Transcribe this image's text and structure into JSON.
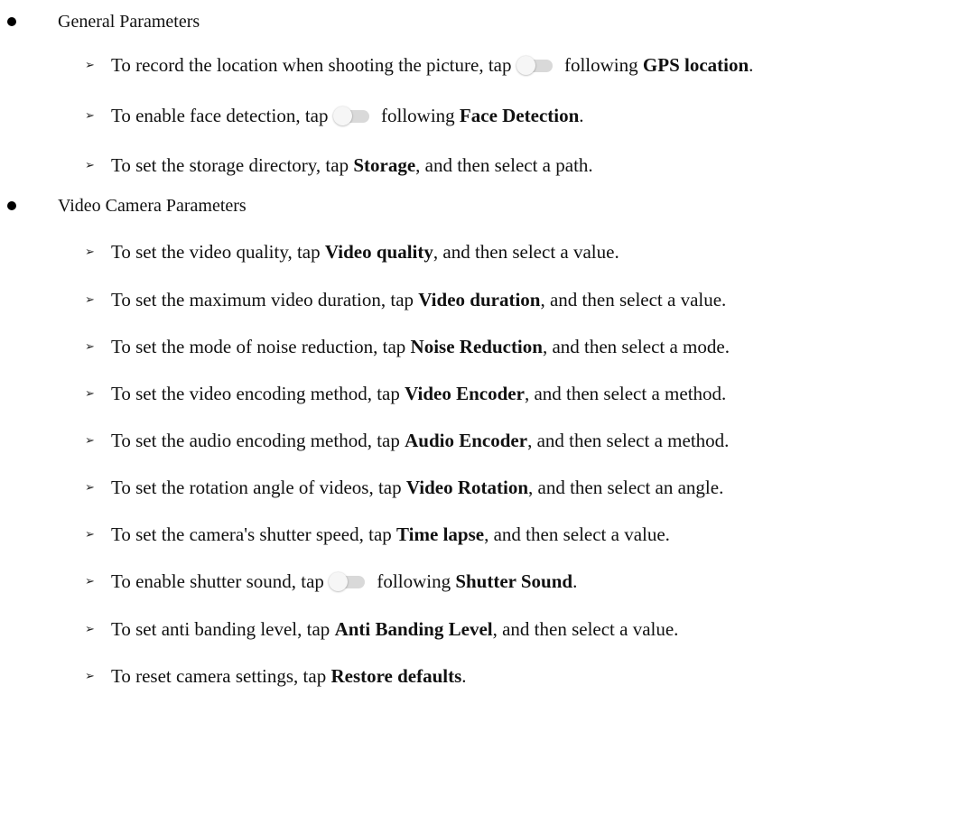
{
  "sections": [
    {
      "title": "General Parameters",
      "items": [
        {
          "pre": "To record the location when shooting the picture, tap ",
          "toggle": true,
          "mid": " following ",
          "bold": "GPS location",
          "post": "."
        },
        {
          "pre": "To enable face detection, tap ",
          "toggle": true,
          "mid": " following ",
          "bold": "Face Detection",
          "post": "."
        },
        {
          "pre": "To set the storage directory, tap ",
          "toggle": false,
          "mid": "",
          "bold": "Storage",
          "post": ", and then select a path."
        }
      ]
    },
    {
      "title": "Video Camera Parameters",
      "items": [
        {
          "pre": "To set the video quality, tap ",
          "toggle": false,
          "mid": "",
          "bold": "Video quality",
          "post": ", and then select a value."
        },
        {
          "pre": "To set the maximum video duration, tap ",
          "toggle": false,
          "mid": "",
          "bold": "Video duration",
          "post": ", and then select a value."
        },
        {
          "pre": "To set the mode of noise reduction, tap ",
          "toggle": false,
          "mid": "",
          "bold": "Noise Reduction",
          "post": ", and then select a mode."
        },
        {
          "pre": "To set the video encoding method, tap ",
          "toggle": false,
          "mid": "",
          "bold": "Video Encoder",
          "post": ", and then select a method."
        },
        {
          "pre": "To set the audio encoding method, tap ",
          "toggle": false,
          "mid": "",
          "bold": "Audio Encoder",
          "post": ", and then select a method."
        },
        {
          "pre": "To set the rotation angle of videos, tap ",
          "toggle": false,
          "mid": "",
          "bold": "Video Rotation",
          "post": ", and then select an angle."
        },
        {
          "pre": "To set the camera's shutter speed, tap ",
          "toggle": false,
          "mid": "",
          "bold": "Time lapse",
          "post": ", and then select a value."
        },
        {
          "pre": "To enable shutter sound, tap ",
          "toggle": true,
          "mid": " following ",
          "bold": "Shutter Sound",
          "post": "."
        },
        {
          "pre": "To set anti banding level, tap ",
          "toggle": false,
          "mid": "",
          "bold": "Anti Banding Level",
          "post": ", and then select a value."
        },
        {
          "pre": "To reset camera settings, tap ",
          "toggle": false,
          "mid": "",
          "bold": "Restore defaults",
          "post": "."
        }
      ]
    }
  ],
  "arrow_glyph": "➢",
  "icons": {
    "section_bullet": "filled-circle-bullet",
    "item_bullet": "arrowhead-bullet",
    "toggle": "toggle-switch-off-icon"
  },
  "colors": {
    "text": "#111111",
    "toggle_track": "#d9d9d9",
    "toggle_knob": "#f6f6f6"
  }
}
